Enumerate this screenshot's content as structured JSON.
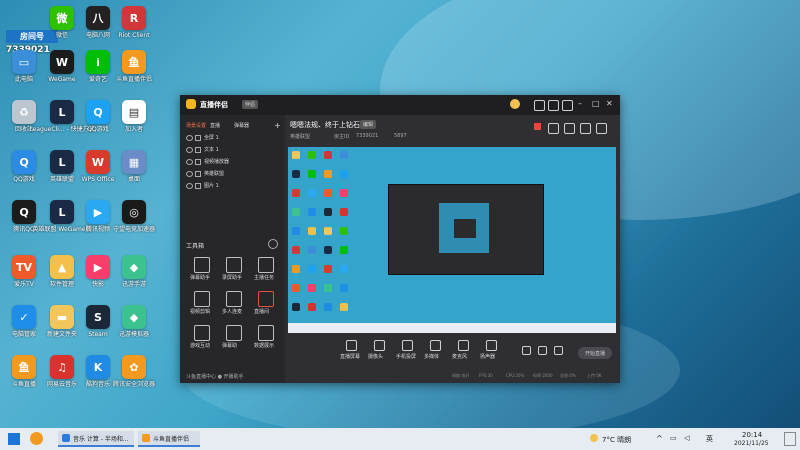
{
  "desktop": {
    "live_badge": {
      "title": "房间号",
      "room": "7339021"
    },
    "icons": [
      {
        "label": "微信",
        "color": "#2dc100",
        "glyph": "微"
      },
      {
        "label": "电脑八网",
        "color": "#222222",
        "glyph": "八"
      },
      {
        "label": "Riot Client",
        "color": "#d13639",
        "glyph": "R"
      },
      {
        "label": "此电脑",
        "color": "#3a8fd8",
        "glyph": "▭"
      },
      {
        "label": "WeGame",
        "color": "#1b1b1b",
        "glyph": "W"
      },
      {
        "label": "爱奇艺",
        "color": "#00be06",
        "glyph": "i"
      },
      {
        "label": "斗鱼直播伴侣",
        "color": "#f29a1f",
        "glyph": "鱼"
      },
      {
        "label": "回收站",
        "color": "#bcc6cf",
        "glyph": "♻"
      },
      {
        "label": "LeagueCli... - 快捷方式",
        "color": "#1a2a44",
        "glyph": "L"
      },
      {
        "label": "QQ游戏",
        "color": "#1da1f2",
        "glyph": "Q"
      },
      {
        "label": "加入者",
        "color": "#ffffff",
        "glyph": "▤"
      },
      {
        "label": "QQ游戏",
        "color": "#2b8be5",
        "glyph": "Q"
      },
      {
        "label": "英雄联盟",
        "color": "#1a2a44",
        "glyph": "L"
      },
      {
        "label": "WPS Office",
        "color": "#d83b2b",
        "glyph": "W"
      },
      {
        "label": "桌面",
        "color": "#6a8cc7",
        "glyph": "▦"
      },
      {
        "label": "腾讯QQ",
        "color": "#1c1c1c",
        "glyph": "Q"
      },
      {
        "label": "英雄联盟 WeGame版",
        "color": "#1a2a44",
        "glyph": "L"
      },
      {
        "label": "腾讯视频",
        "color": "#2aa8f2",
        "glyph": "▶"
      },
      {
        "label": "守望电竞加速器",
        "color": "#1a1a1a",
        "glyph": "◎"
      },
      {
        "label": "爱乐TV",
        "color": "#f05a28",
        "glyph": "TV"
      },
      {
        "label": "软件管理",
        "color": "#f5c04a",
        "glyph": "▲"
      },
      {
        "label": "快影",
        "color": "#fa3e6c",
        "glyph": "▶"
      },
      {
        "label": "迅游手游",
        "color": "#3cc28f",
        "glyph": "◆"
      },
      {
        "label": "电脑管家",
        "color": "#1e8ee8",
        "glyph": "✓"
      },
      {
        "label": "新建文件夹",
        "color": "#f3c65b",
        "glyph": "▬"
      },
      {
        "label": "Steam",
        "color": "#1b2838",
        "glyph": "S"
      },
      {
        "label": "迅游模拟器",
        "color": "#3cc28f",
        "glyph": "◆"
      },
      {
        "label": "斗鱼直播",
        "color": "#f29a1f",
        "glyph": "鱼"
      },
      {
        "label": "网易云音乐",
        "color": "#d9312b",
        "glyph": "♫"
      },
      {
        "label": "酷狗音乐",
        "color": "#1f8be5",
        "glyph": "K"
      },
      {
        "label": "腾讯安全浏览器",
        "color": "#f29a1f",
        "glyph": "✿"
      }
    ]
  },
  "app": {
    "title": "直播伴侣",
    "badge": "伴侣",
    "tabs": [
      "场景设置",
      "直播",
      "弹幕器"
    ],
    "scenes": [
      "全屏 1",
      "文本 1",
      "视频播放器",
      "英雄联盟",
      "图片 1"
    ],
    "live_title": "嗯嗯法规、终于上钻石了",
    "edit_label": "编辑",
    "room_label": "房主ID",
    "room_id": "7339021",
    "fans": "5897",
    "category": "英雄联盟",
    "tools_label": "工具箱",
    "tools": [
      "弹幕助手",
      "录屏助手",
      "主播任务",
      "视频剪辑",
      "多人连麦",
      "直播间",
      "游戏互动",
      "弹幕助",
      "数据展示"
    ],
    "bottom_buttons": [
      "直播屏幕",
      "摄像头",
      "手机投屏",
      "多媒体",
      "麦克风",
      "扬声器"
    ],
    "start_button": "开始直播",
    "status_bar": "斗鱼直播中心 ● 开播助手",
    "stats": [
      "网络:良好",
      "FPS:30",
      "CPU:20%",
      "码率:2000",
      "丢帧:0%",
      "上传:0K"
    ]
  },
  "taskbar": {
    "items": [
      "音乐 计算 - 半场和...",
      "斗鱼直播伴侣"
    ],
    "weather": "7°C 晴朗",
    "ime": "英",
    "time": "20:14",
    "date": "2021/11/25"
  }
}
